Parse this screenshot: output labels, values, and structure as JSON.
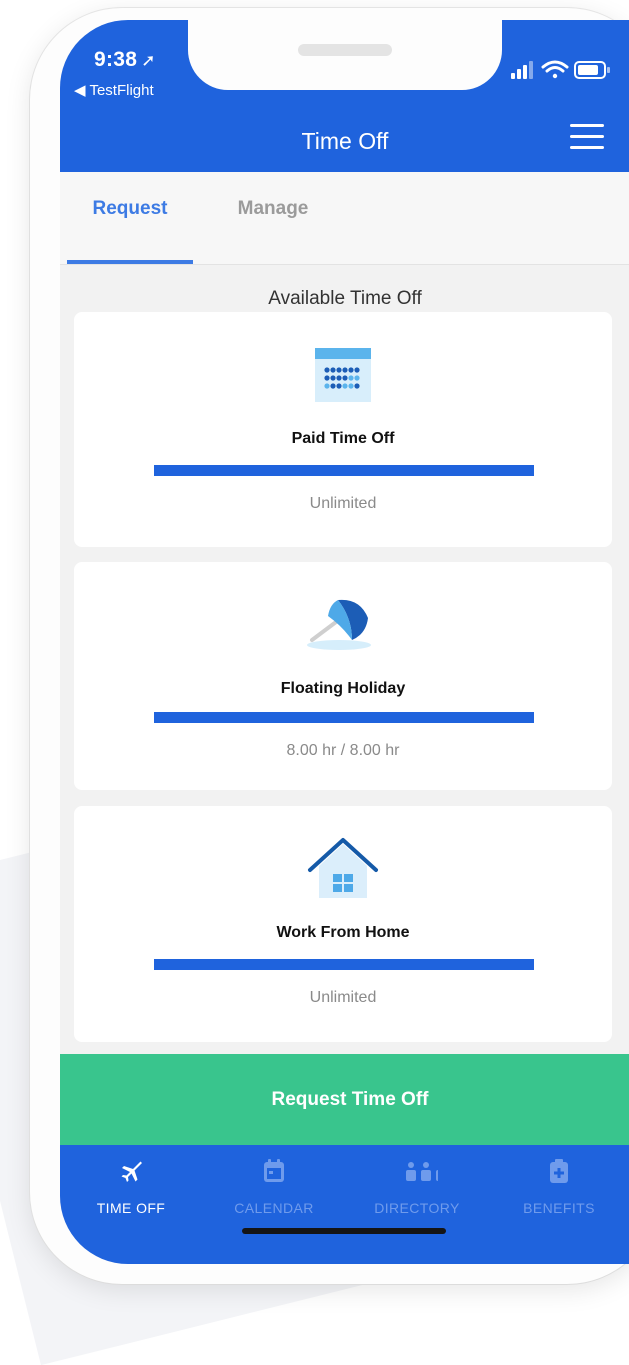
{
  "status_bar": {
    "time": "9:38",
    "back_app": "TestFlight"
  },
  "header": {
    "title": "Time Off"
  },
  "tabs": [
    {
      "label": "Request",
      "active": true
    },
    {
      "label": "Manage",
      "active": false
    }
  ],
  "section_title": "Available Time Off",
  "cards": [
    {
      "name": "Paid Time Off",
      "amount": "Unlimited",
      "icon": "calendar-icon",
      "fill_fraction": 1.0
    },
    {
      "name": "Floating Holiday",
      "amount": "8.00 hr / 8.00 hr",
      "icon": "beach-umbrella-icon",
      "fill_fraction": 1.0
    },
    {
      "name": "Work From Home",
      "amount": "Unlimited",
      "icon": "house-icon",
      "fill_fraction": 1.0
    }
  ],
  "request_button_label": "Request Time Off",
  "bottom_nav": [
    {
      "label": "TIME OFF",
      "icon": "airplane-icon",
      "active": true
    },
    {
      "label": "CALENDAR",
      "icon": "calendar-icon",
      "active": false
    },
    {
      "label": "DIRECTORY",
      "icon": "people-icon",
      "active": false
    },
    {
      "label": "BENEFITS",
      "icon": "medical-kit-icon",
      "active": false
    }
  ],
  "colors": {
    "primary_blue": "#1f63dd",
    "tab_blue": "#3d7be4",
    "green": "#39c58d",
    "background": "#f2f2f2"
  }
}
